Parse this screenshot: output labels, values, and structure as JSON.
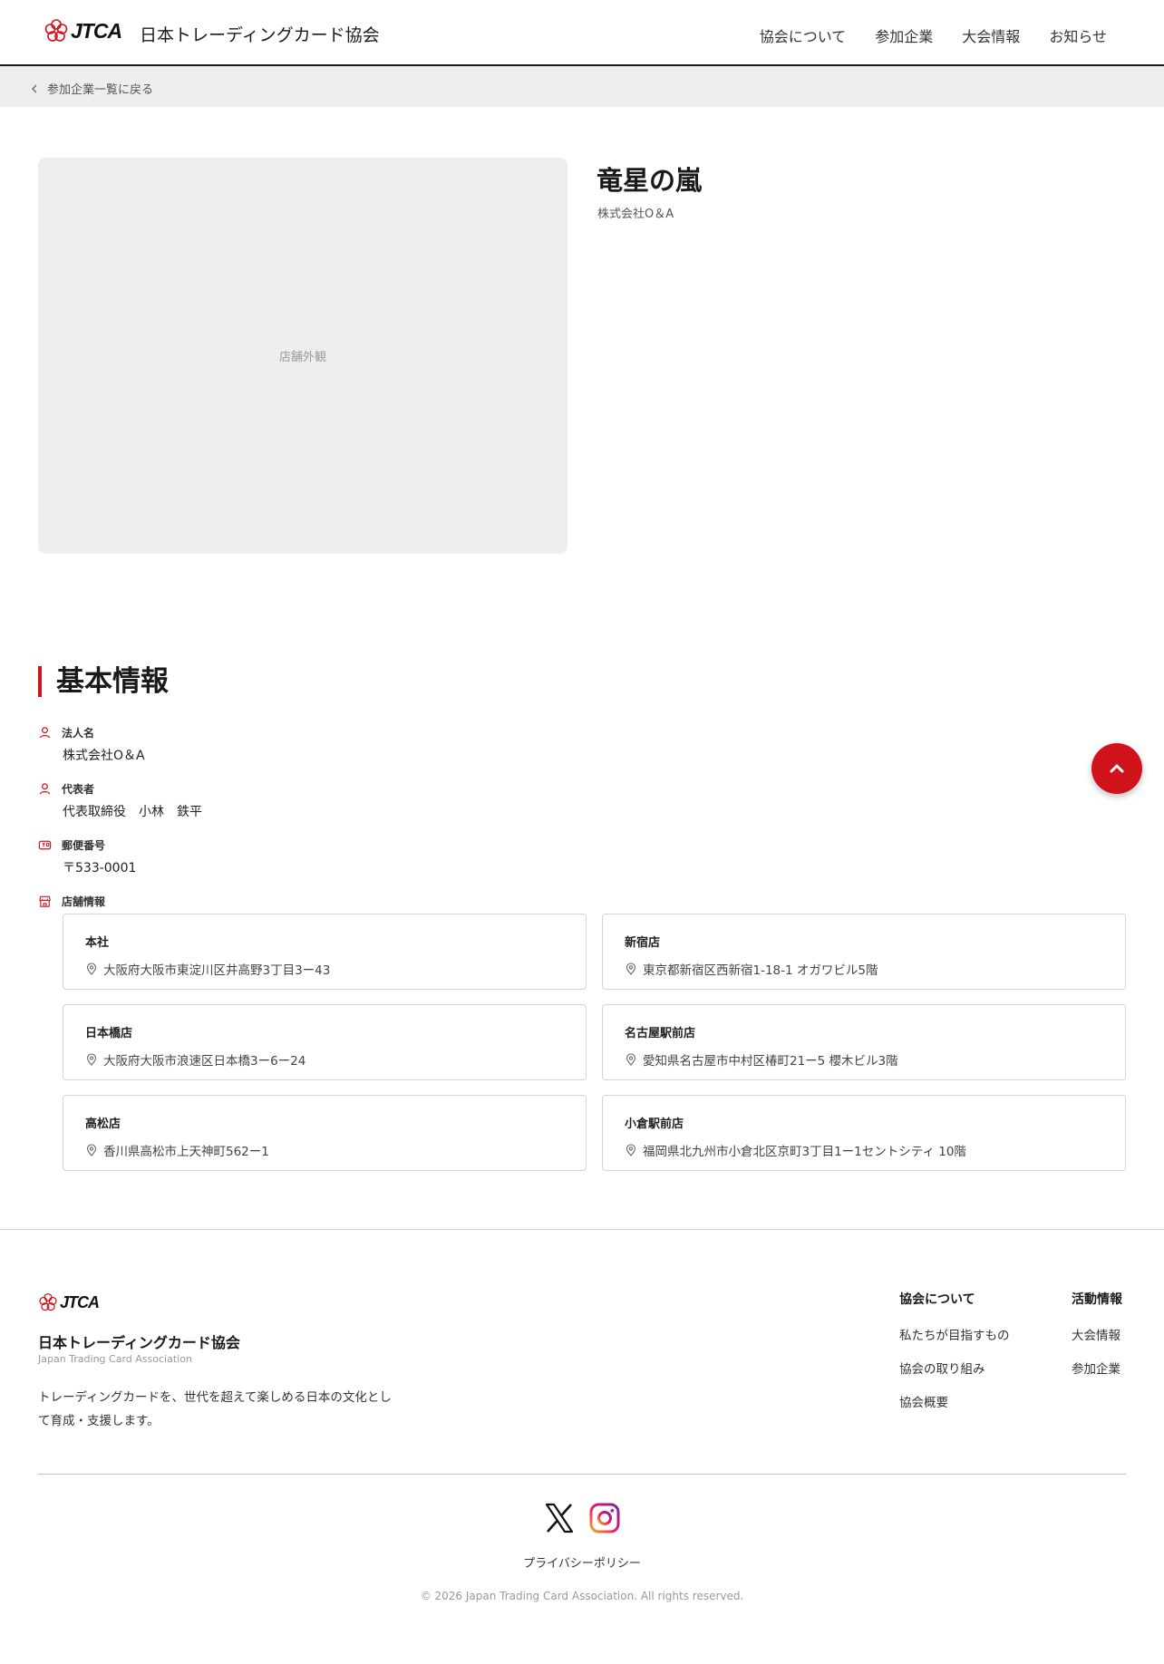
{
  "header": {
    "logo_text": "JTCA",
    "site_title": "日本トレーディングカード協会",
    "nav": [
      "協会について",
      "参加企業",
      "大会情報",
      "お知らせ"
    ]
  },
  "breadcrumb": {
    "back_label": "参加企業一覧に戻る"
  },
  "hero": {
    "photo_placeholder": "店舗外観",
    "store_name": "竜星の嵐",
    "company": "株式会社O＆A"
  },
  "basic_info": {
    "title": "基本情報",
    "corporate_label": "法人名",
    "corporate_value": "株式会社O＆A",
    "rep_label": "代表者",
    "rep_value": "代表取締役　小林　鉄平",
    "postal_label": "郵便番号",
    "postal_value": "〒533-0001",
    "stores_label": "店舗情報",
    "stores": [
      {
        "name": "本社",
        "address": "大阪府大阪市東淀川区井高野3丁目3ー43"
      },
      {
        "name": "新宿店",
        "address": "東京都新宿区西新宿1-18-1 オガワビル5階"
      },
      {
        "name": "日本橋店",
        "address": "大阪府大阪市浪速区日本橋3ー6ー24"
      },
      {
        "name": "名古屋駅前店",
        "address": "愛知県名古屋市中村区椿町21ー5 櫻木ビル3階"
      },
      {
        "name": "高松店",
        "address": "香川県高松市上天神町562ー1"
      },
      {
        "name": "小倉駅前店",
        "address": "福岡県北九州市小倉北区京町3丁目1ー1セントシティ 10階"
      }
    ]
  },
  "footer": {
    "logo_text": "JTCA",
    "title": "日本トレーディングカード協会",
    "subtitle": "Japan Trading Card Association",
    "description": "トレーディングカードを、世代を超えて楽しめる日本の文化として育成・支援します。",
    "col1": {
      "heading": "協会について",
      "links": [
        "私たちが目指すもの",
        "協会の取り組み",
        "協会概要"
      ]
    },
    "col2": {
      "heading": "活動情報",
      "links": [
        "大会情報",
        "参加企業"
      ]
    },
    "privacy": "プライバシーポリシー",
    "copyright": "© 2026 Japan Trading Card Association. All rights reserved."
  },
  "colors": {
    "accent": "#d0121b",
    "placeholder_bg": "#eeeeee"
  },
  "icons": [
    "logo-flower-icon",
    "chevron-left-icon",
    "person-icon",
    "postal-card-icon",
    "shop-icon",
    "map-pin-icon",
    "chevron-up-icon",
    "x-logo-icon",
    "instagram-icon"
  ]
}
